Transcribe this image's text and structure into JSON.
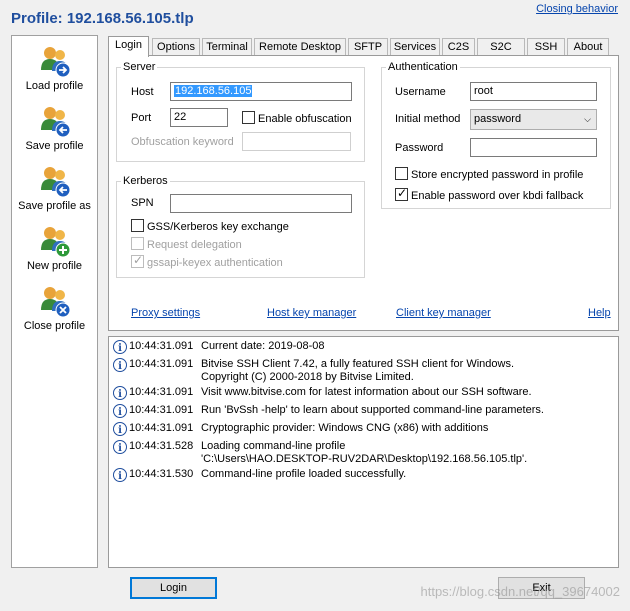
{
  "window": {
    "title": "Profile: 192.168.56.105.tlp",
    "closing_behavior_link": "Closing behavior"
  },
  "sidebar": {
    "items": [
      {
        "label": "Load profile",
        "icon": "users-arrow-right-icon"
      },
      {
        "label": "Save profile",
        "icon": "users-arrow-left-icon"
      },
      {
        "label": "Save profile as",
        "icon": "users-arrow-left-icon"
      },
      {
        "label": "New profile",
        "icon": "users-plus-icon"
      },
      {
        "label": "Close profile",
        "icon": "users-close-icon"
      }
    ]
  },
  "tabs": [
    "Login",
    "Options",
    "Terminal",
    "Remote Desktop",
    "SFTP",
    "Services",
    "C2S",
    "S2C",
    "SSH",
    "About"
  ],
  "active_tab": "Login",
  "login": {
    "server": {
      "legend": "Server",
      "host_label": "Host",
      "host_value": "192.168.56.105",
      "port_label": "Port",
      "port_value": "22",
      "obfuscation_label": "Enable obfuscation",
      "obfuscation_checked": false,
      "obf_keyword_label": "Obfuscation keyword",
      "obf_keyword_value": ""
    },
    "kerberos": {
      "legend": "Kerberos",
      "spn_label": "SPN",
      "spn_value": "",
      "gss_label": "GSS/Kerberos key exchange",
      "gss_checked": false,
      "request_delegation_label": "Request delegation",
      "gssapi_label": "gssapi-keyex authentication",
      "gssapi_checked": true
    },
    "auth": {
      "legend": "Authentication",
      "username_label": "Username",
      "username_value": "root",
      "method_label": "Initial method",
      "method_value": "password",
      "password_label": "Password",
      "password_value": "",
      "store_pw_label": "Store encrypted password in profile",
      "store_pw_checked": false,
      "kbdi_label": "Enable password over kbdi fallback",
      "kbdi_checked": true
    },
    "links": {
      "proxy": "Proxy settings",
      "host_key": "Host key manager",
      "client_key": "Client key manager",
      "help": "Help"
    }
  },
  "log": [
    {
      "time": "10:44:31.091",
      "msg": "Current date: 2019-08-08",
      "msg2": ""
    },
    {
      "time": "10:44:31.091",
      "msg": "Bitvise SSH Client 7.42, a fully featured SSH client for Windows.",
      "msg2": "Copyright (C) 2000-2018 by Bitvise Limited."
    },
    {
      "time": "10:44:31.091",
      "msg": "Visit www.bitvise.com for latest information about our SSH software.",
      "msg2": ""
    },
    {
      "time": "10:44:31.091",
      "msg": "Run 'BvSsh -help' to learn about supported command-line parameters.",
      "msg2": ""
    },
    {
      "time": "10:44:31.091",
      "msg": "Cryptographic provider: Windows CNG (x86) with additions",
      "msg2": ""
    },
    {
      "time": "10:44:31.528",
      "msg": "Loading command-line profile",
      "msg2": "'C:\\Users\\HAO.DESKTOP-RUV2DAR\\Desktop\\192.168.56.105.tlp'."
    },
    {
      "time": "10:44:31.530",
      "msg": "Command-line profile loaded successfully.",
      "msg2": ""
    }
  ],
  "buttons": {
    "login": "Login",
    "exit": "Exit"
  },
  "watermark": "https://blog.csdn.net/qq_39674002",
  "colors": {
    "title": "#1f4e9e",
    "link": "#0645ad",
    "selection": "#3399ff",
    "default_button_border": "#0078d7"
  }
}
